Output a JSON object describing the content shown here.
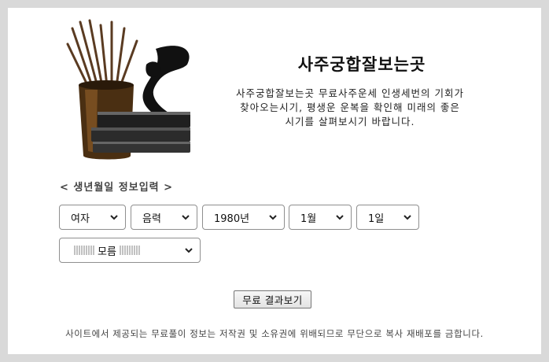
{
  "header": {
    "title": "사주궁합잘보는곳",
    "description_line1": "사주궁합잘보는곳 무료사주운세 인생세번의 기회가",
    "description_line2": "찾아오는시기, 평생운 운복을 확인해 미래의 좋은",
    "description_line3": "시기를 살펴보시기 바랍니다."
  },
  "form": {
    "section_label": "< 생년월일 정보입력 >",
    "gender": "여자",
    "calendar": "음력",
    "year": "1980년",
    "month": "1월",
    "day": "1일",
    "hour": "모름",
    "submit_label": "무료 결과보기"
  },
  "footer": {
    "notice": "사이트에서 제공되는 무료풀이 정보는 저작권 및 소유권에 위배되므로 무단으로 복사 재배포를 금합니다."
  },
  "icons": [
    "brush-pot-logo",
    "chevron-down-icon"
  ]
}
